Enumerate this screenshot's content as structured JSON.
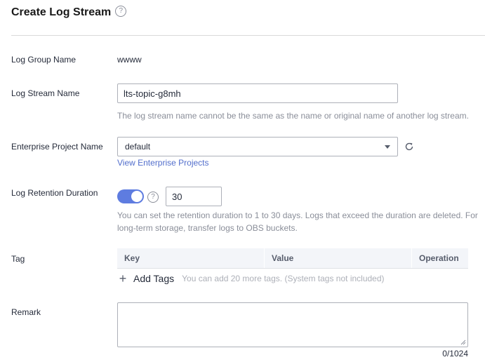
{
  "header": {
    "title": "Create Log Stream",
    "help_glyph": "?"
  },
  "log_group": {
    "label": "Log Group Name",
    "value": "wwww"
  },
  "log_stream": {
    "label": "Log Stream Name",
    "value": "lts-topic-g8mh",
    "hint": "The log stream name cannot be the same as the name or original name of another log stream."
  },
  "enterprise_project": {
    "label": "Enterprise Project Name",
    "selected": "default",
    "view_link": "View Enterprise Projects",
    "refresh_icon": "refresh-icon"
  },
  "retention": {
    "label": "Log Retention Duration",
    "enabled": true,
    "help_glyph": "?",
    "days": "30",
    "hint_line1": "You can set the retention duration to 1 to 30 days. Logs that exceed the duration are deleted. For",
    "hint_line2": "long-term storage, transfer logs to OBS buckets."
  },
  "tag": {
    "label": "Tag",
    "columns": [
      "Key",
      "Value",
      "Operation"
    ],
    "add_icon": "+",
    "add_label": "Add Tags",
    "add_hint": "You can add 20 more tags. (System tags not included)"
  },
  "remark": {
    "label": "Remark",
    "value": "",
    "counter": "0/1024"
  },
  "colors": {
    "accent": "#5e7ce0",
    "link": "#526ecc",
    "hint": "#8a8e99",
    "table_header_bg": "#f3f5f9"
  }
}
